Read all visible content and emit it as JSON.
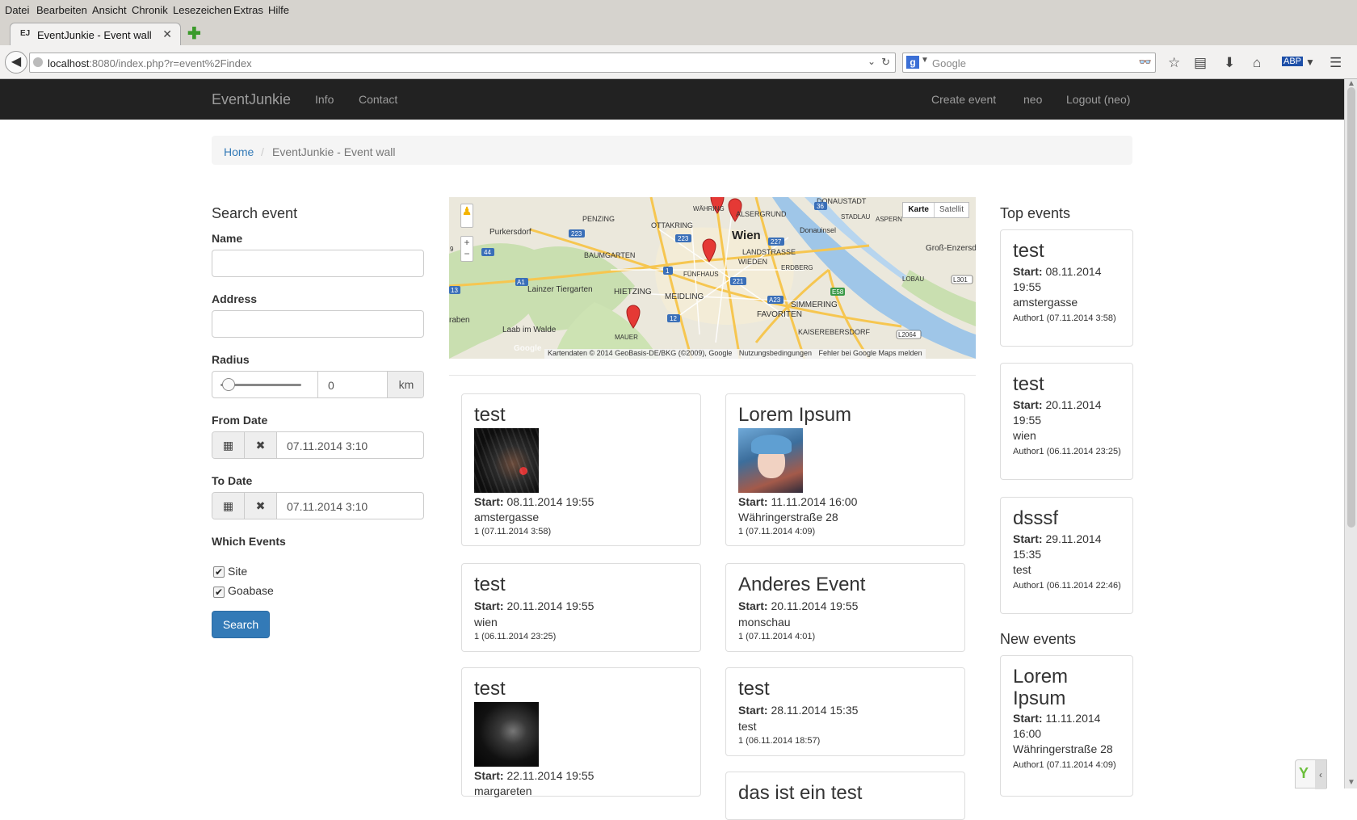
{
  "browser": {
    "menu": [
      "Datei",
      "Bearbeiten",
      "Ansicht",
      "Chronik",
      "Lesezeichen",
      "Extras",
      "Hilfe"
    ],
    "tab_title": "EventJunkie - Event wall",
    "tab_favicon": "EJ",
    "url_host": "localhost",
    "url_rest": ":8080/index.php?r=event%2Findex",
    "search_placeholder": "Google"
  },
  "site_nav": {
    "brand": "EventJunkie",
    "links": [
      "Info",
      "Contact"
    ],
    "right_links": [
      "Create event",
      "neo",
      "Logout (neo)"
    ]
  },
  "breadcrumb": {
    "home": "Home",
    "separator": "/",
    "current": "EventJunkie - Event wall"
  },
  "search_form": {
    "title": "Search event",
    "name_label": "Name",
    "address_label": "Address",
    "radius_label": "Radius",
    "radius_value": "0",
    "radius_unit": "km",
    "from_label": "From Date",
    "from_value": "07.11.2014 3:10",
    "to_label": "To Date",
    "to_value": "07.11.2014 3:10",
    "which_label": "Which Events",
    "options": [
      {
        "label": "Site",
        "checked": true
      },
      {
        "label": "Goabase",
        "checked": true
      }
    ],
    "search_button": "Search"
  },
  "map": {
    "type_buttons": [
      "Karte",
      "Satellit"
    ],
    "city_label": "Wien",
    "place_labels": [
      "Purkersdorf",
      "PENZING",
      "OTTAKRING",
      "WÄHRING",
      "ALSERGRUND",
      "DONAUSTADT",
      "STADLAU",
      "ASPERN",
      "Donauinsel",
      "LANDSTRASSE",
      "WIEDEN",
      "Groß-Enzersd",
      "BAUMGARTEN",
      "Lainzer Tiergarten",
      "HIETZING",
      "FÜNFHAUS",
      "ERDBERG",
      "LOBAU",
      "MEIDLING",
      "FAVORITEN",
      "SIMMERING",
      "KAISEREBERSDORF",
      "MAUER",
      "Laab im Walde",
      "raben",
      "Wien"
    ],
    "road_labels": [
      "223",
      "223",
      "227",
      "44",
      "A1",
      "1",
      "221",
      "A23",
      "E58",
      "12",
      "L301",
      "L2064",
      "36",
      "13",
      "9"
    ],
    "logo": "Google",
    "attribution": "Kartendaten © 2014 GeoBasis-DE/BKG (©2009), Google",
    "terms": "Nutzungsbedingungen",
    "report": "Fehler bei Google Maps melden"
  },
  "start_label": "Start:",
  "events": [
    {
      "title": "test",
      "start": "08.11.2014 19:55",
      "address": "amstergasse",
      "meta": "1 (07.11.2014 3:58)",
      "image": "dark-art"
    },
    {
      "title": "Lorem Ipsum",
      "start": "11.11.2014 16:00",
      "address": "Währingerstraße 28",
      "meta": "1 (07.11.2014 4:09)",
      "image": "anime-girl"
    },
    {
      "title": "test",
      "start": "20.11.2014 19:55",
      "address": "wien",
      "meta": "1 (06.11.2014 23:25)"
    },
    {
      "title": "Anderes Event",
      "start": "20.11.2014 19:55",
      "address": "monschau",
      "meta": "1 (07.11.2014 4:01)"
    },
    {
      "title": "test",
      "start": "22.11.2014 19:55",
      "address": "margareten",
      "meta": "",
      "image": "dark-figure"
    },
    {
      "title": "test",
      "start": "28.11.2014 15:35",
      "address": "test",
      "meta": "1 (06.11.2014 18:57)"
    },
    {
      "title": "das ist ein test"
    }
  ],
  "top_events": {
    "heading": "Top events",
    "items": [
      {
        "title": "test",
        "start": "08.11.2014 19:55",
        "address": "amstergasse",
        "meta": "Author1 (07.11.2014 3:58)"
      },
      {
        "title": "test",
        "start": "20.11.2014 19:55",
        "address": "wien",
        "meta": "Author1 (06.11.2014 23:25)"
      },
      {
        "title": "dsssf",
        "start": "29.11.2014 15:35",
        "address": "test",
        "meta": "Author1 (06.11.2014 22:46)"
      }
    ]
  },
  "new_events": {
    "heading": "New events",
    "items": [
      {
        "title": "Lorem Ipsum",
        "start": "11.11.2014 16:00",
        "address": "Währingerstraße 28",
        "meta": "Author1 (07.11.2014 4:09)"
      }
    ]
  }
}
